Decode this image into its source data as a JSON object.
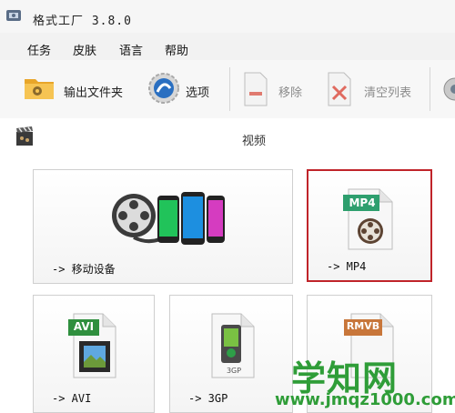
{
  "window": {
    "title": "格式工厂 3.8.0"
  },
  "menu": {
    "items": [
      "任务",
      "皮肤",
      "语言",
      "帮助"
    ]
  },
  "toolbar": {
    "output_folder": "输出文件夹",
    "options": "选项",
    "remove": "移除",
    "clear_list": "清空列表"
  },
  "category": {
    "title": "视频"
  },
  "tiles": {
    "mobile": {
      "label": "-> 移动设备"
    },
    "mp4": {
      "label": "-> MP4",
      "badge": "MP4"
    },
    "avi": {
      "label": "-> AVI",
      "badge": "AVI"
    },
    "gp3": {
      "label": "-> 3GP",
      "badge": "3GP"
    },
    "rmvb": {
      "badge": "RMVB"
    }
  },
  "watermark": {
    "line1": "学知网",
    "line2": "www.jmqz1000.com"
  },
  "colors": {
    "selected_border": "#c0242a",
    "watermark": "#2f9d38"
  }
}
